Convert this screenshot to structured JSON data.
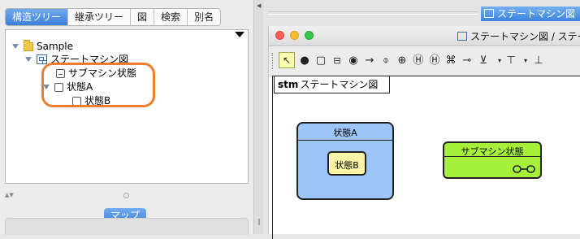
{
  "left_panel": {
    "tabs": [
      "構造ツリー",
      "継承ツリー",
      "図",
      "検索",
      "別名"
    ],
    "active_tab": "構造ツリー",
    "tree": [
      {
        "label": "Sample",
        "icon": "package-icon",
        "expanded": true
      },
      {
        "label": "ステートマシン図",
        "icon": "statemachine-diagram-icon",
        "expanded": true
      },
      {
        "label": "サブマシン状態",
        "icon": "submachine-state-icon"
      },
      {
        "label": "状態A",
        "icon": "state-icon",
        "expanded": true
      },
      {
        "label": "状態B",
        "icon": "state-icon"
      }
    ],
    "highlight_color": "#ef7d30",
    "map_button": "マップ"
  },
  "top_title": "ステートマシン図",
  "window": {
    "title": "ステートマシン図 / ステー",
    "traffic_lights": [
      "#fc5f57",
      "#fdbc2e",
      "#34c84a"
    ],
    "toolbar_icons": [
      "select-arrow-icon",
      "initial-state-icon",
      "state-icon",
      "submachine-state-icon",
      "final-state-icon",
      "transition-icon",
      "choice-icon",
      "junction-icon",
      "shallow-history-icon",
      "deep-history-icon",
      "fork-icon",
      "entry-point-icon",
      "exit-point-icon",
      "terminate-icon",
      "more-icon"
    ],
    "frame_keyword": "stm",
    "frame_name": "ステートマシン図",
    "states": {
      "a": {
        "name": "状態A",
        "color": "#9ec5f7"
      },
      "b": {
        "name": "状態B",
        "color": "#fbf6a6"
      },
      "submachine": {
        "name": "サブマシン状態",
        "color": "#a6ef3a"
      }
    }
  }
}
